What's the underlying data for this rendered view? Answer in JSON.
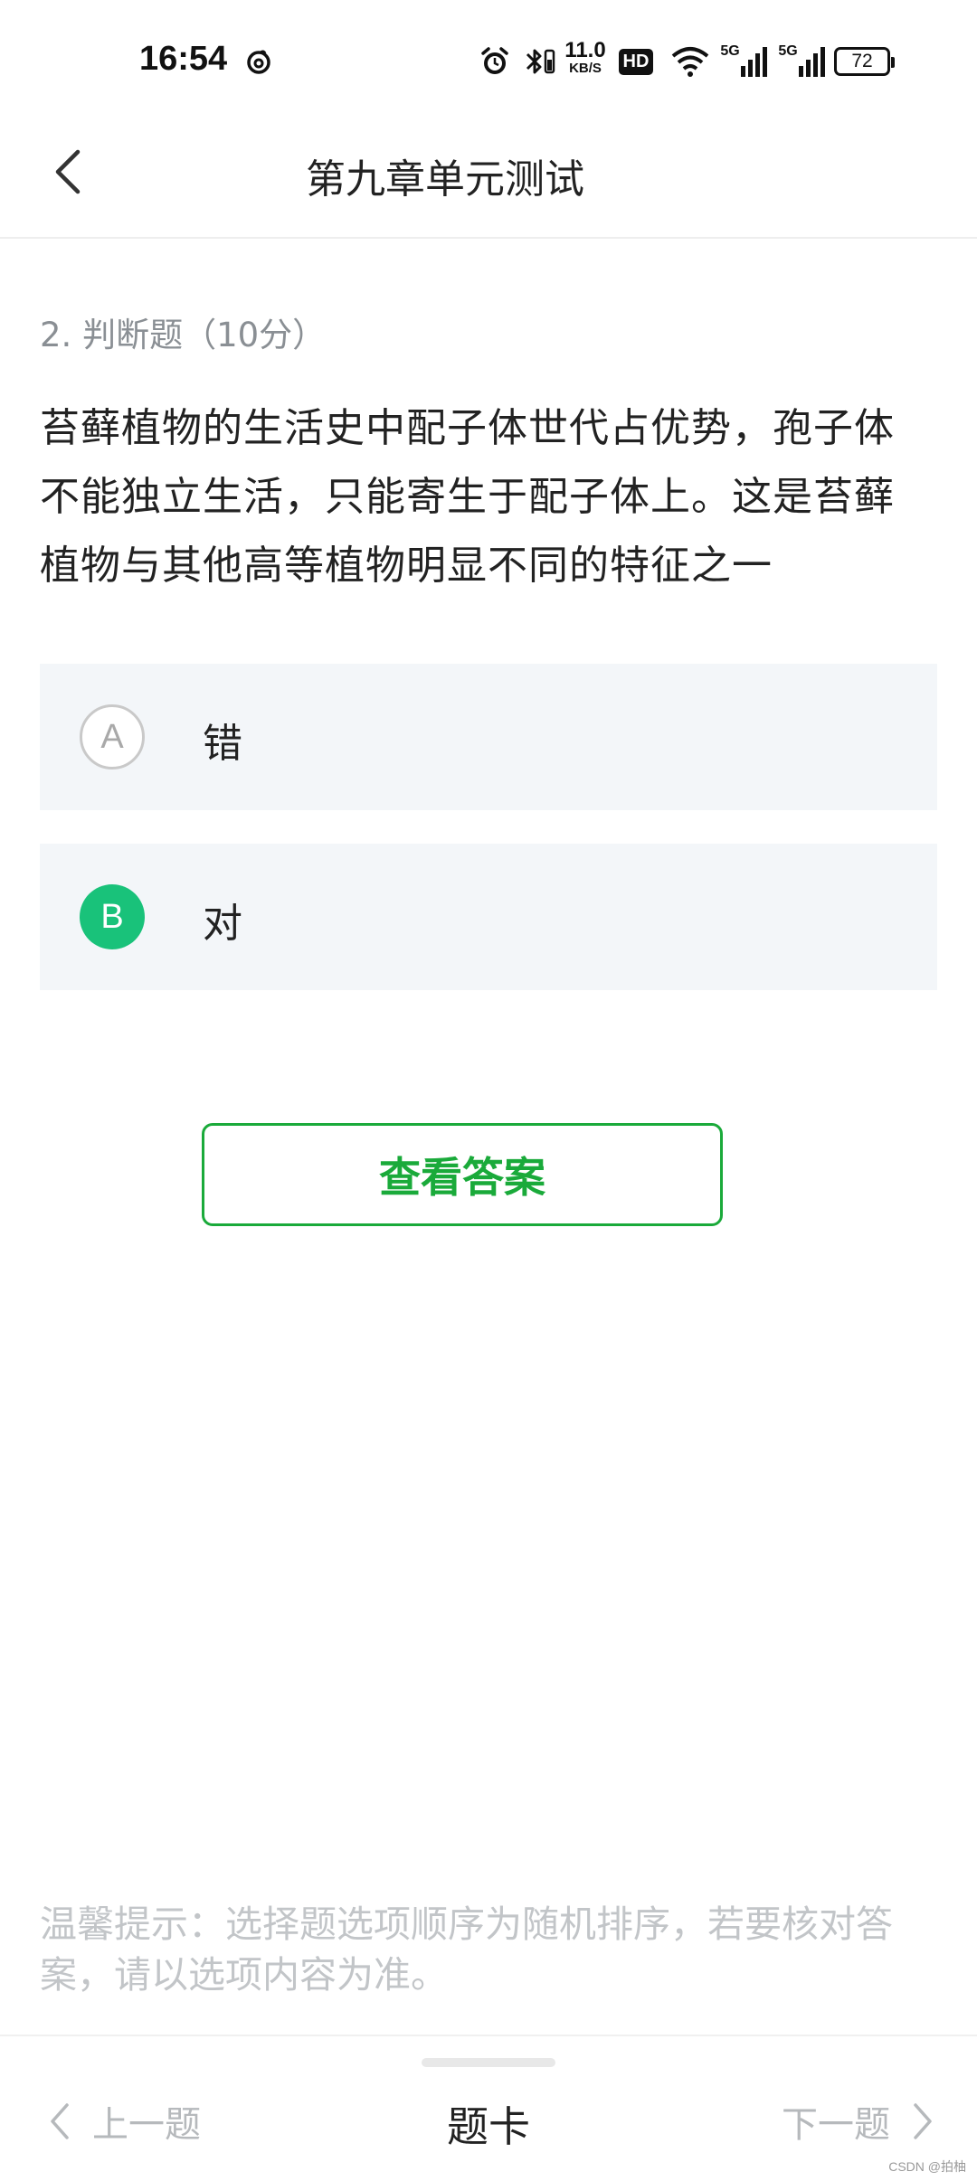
{
  "status_bar": {
    "time": "16:54",
    "net_speed_value": "11.0",
    "net_speed_unit": "KB/S",
    "hd_badge": "HD",
    "signal_1": "5G",
    "signal_2": "5G",
    "battery": "72",
    "icons": [
      "netease-music-icon",
      "alarm-icon",
      "bluetooth-icon",
      "hd-icon",
      "wifi-icon",
      "signal-5g-icon",
      "signal-5g-icon",
      "battery-icon"
    ]
  },
  "header": {
    "title": "第九章单元测试",
    "back_icon": "chevron-left-icon"
  },
  "question": {
    "meta": "2. 判断题（10分）",
    "stem": "苔藓植物的生活史中配子体世代占优势，孢子体不能独立生活，只能寄生于配子体上。这是苔藓植物与其他高等植物明显不同的特征之一"
  },
  "options": [
    {
      "letter": "A",
      "text": "错",
      "selected": false
    },
    {
      "letter": "B",
      "text": "对",
      "selected": true
    }
  ],
  "answer_button": {
    "label": "查看答案"
  },
  "tip": "温馨提示：选择题选项顺序为随机排序，若要核对答案，请以选项内容为准。",
  "bottom_nav": {
    "prev_label": "上一题",
    "card_label": "题卡",
    "next_label": "下一题"
  },
  "watermark": "CSDN @拍柚",
  "colors": {
    "accent_green": "#1aaa3a",
    "selected_green": "#19c27a",
    "option_bg": "#f3f6f9"
  }
}
